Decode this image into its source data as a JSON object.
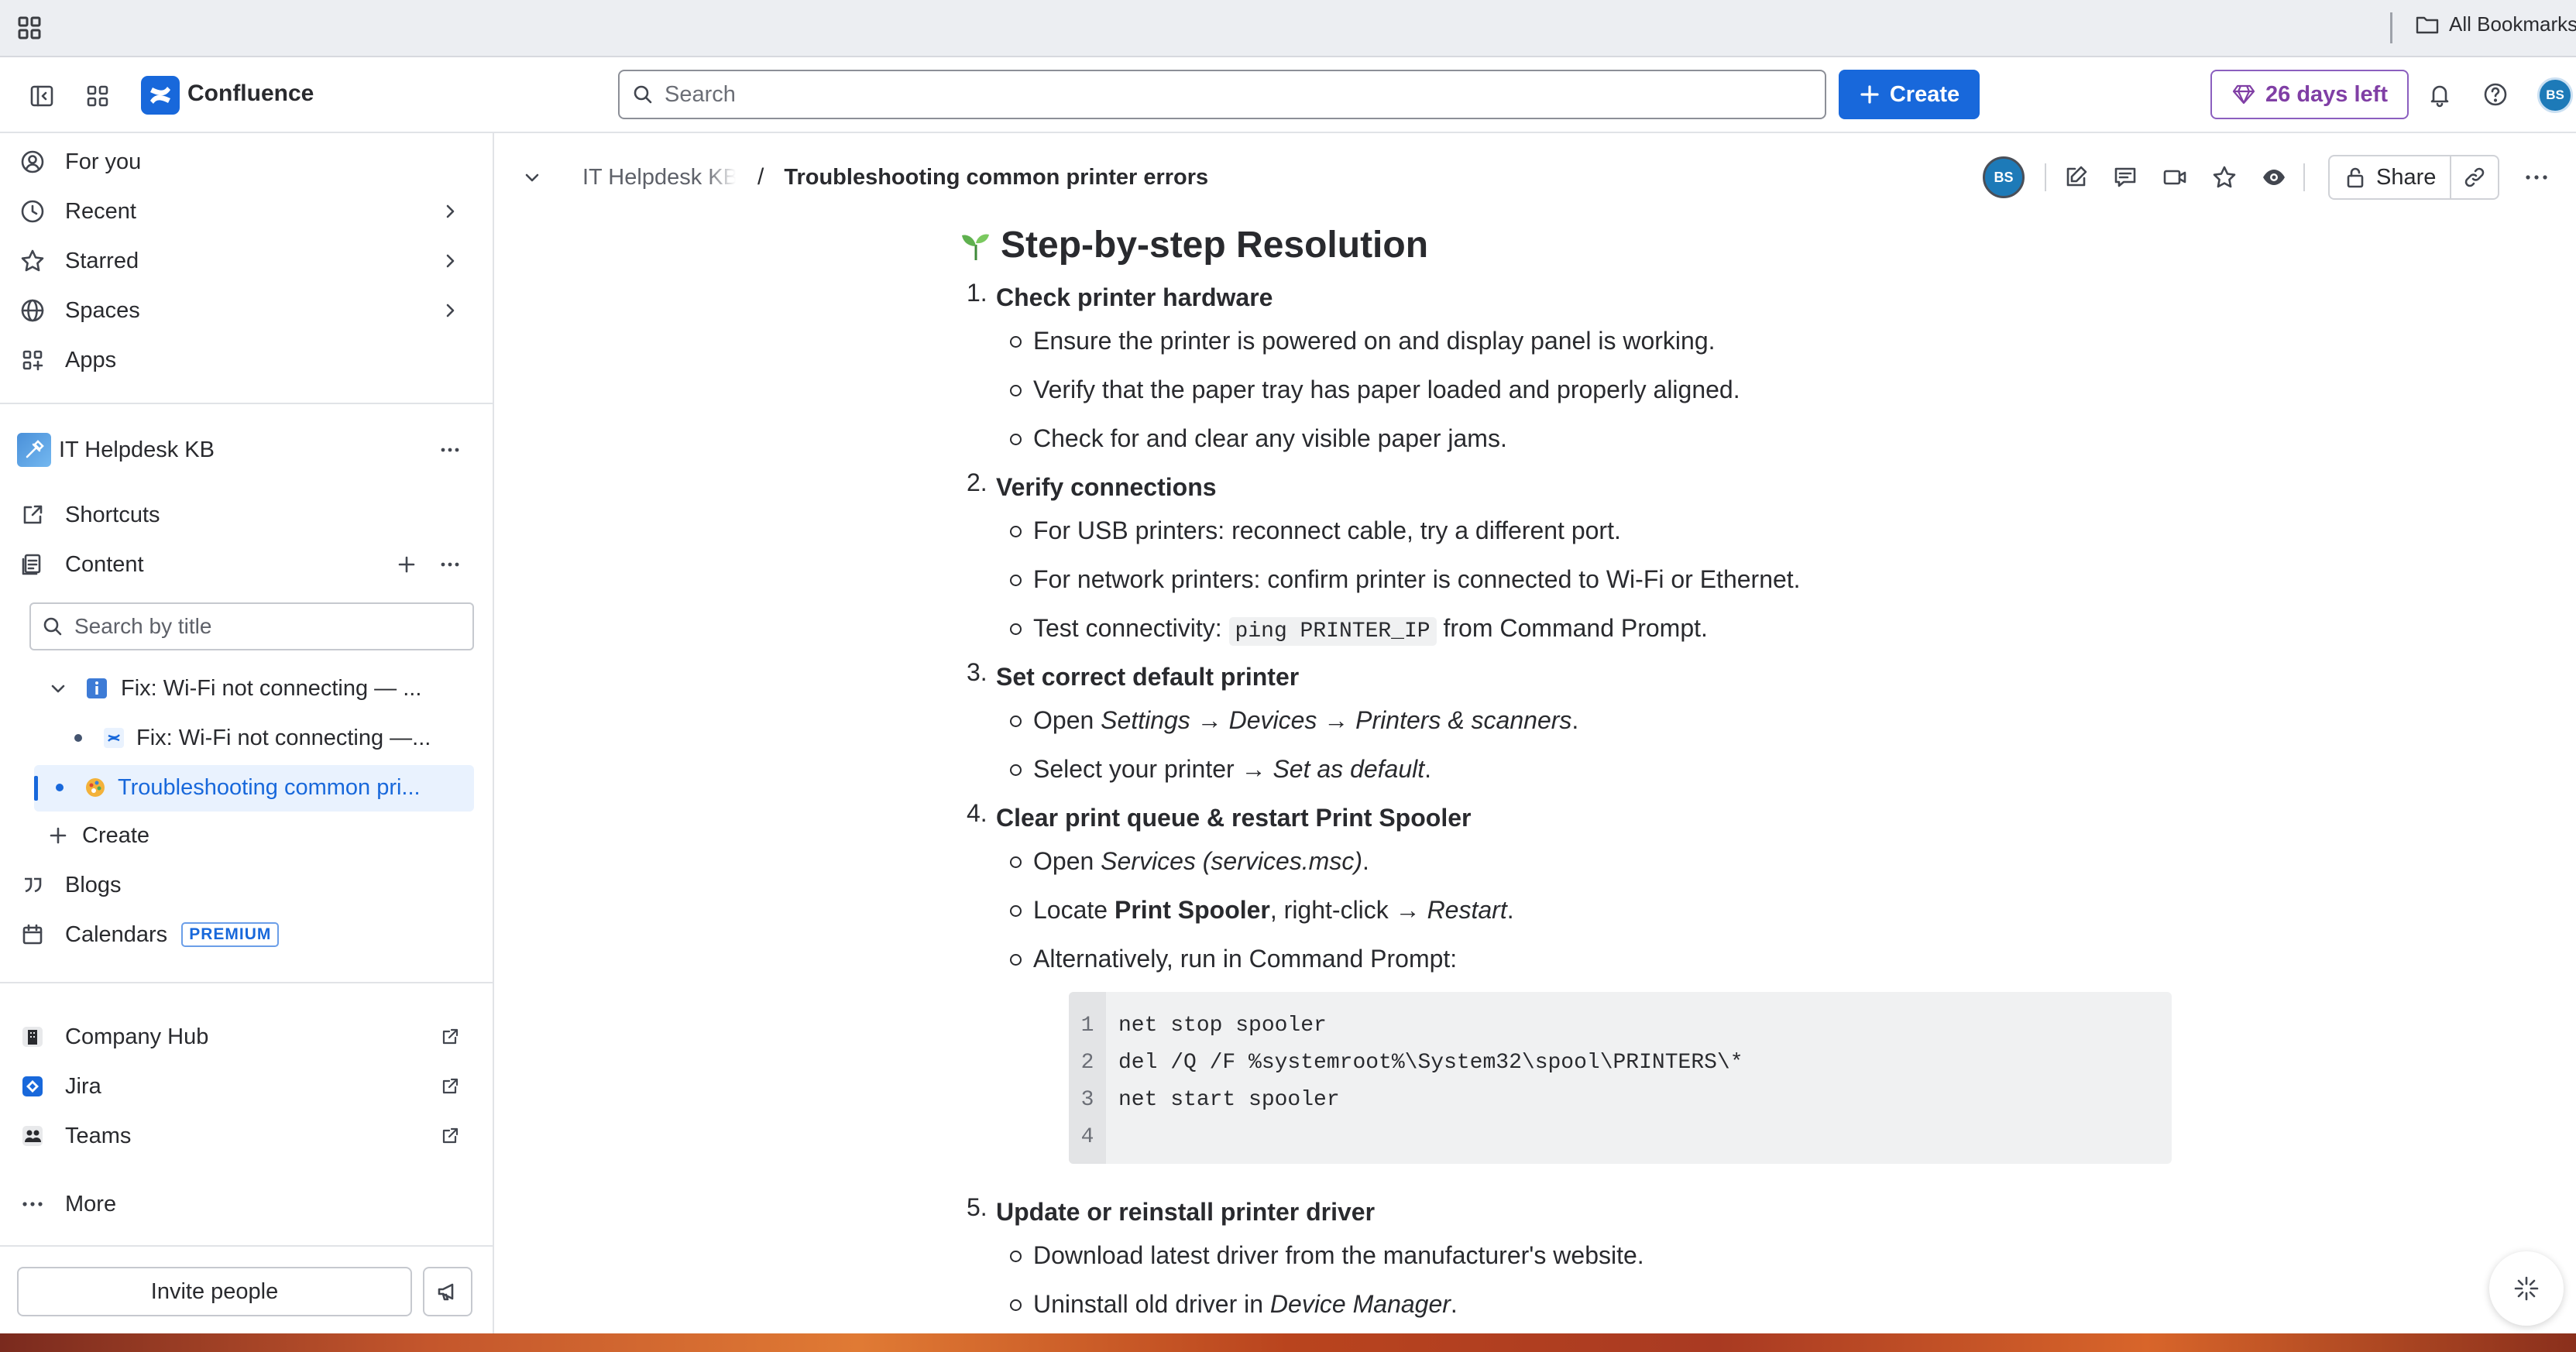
{
  "browser": {
    "bookmarks_label": "All Bookmarks"
  },
  "header": {
    "product_name": "Confluence",
    "search_placeholder": "Search",
    "create_label": "Create",
    "trial_label": "26 days left",
    "avatar_initials": "BS",
    "brand_color": "#1868db"
  },
  "sidebar": {
    "nav": [
      {
        "label": "For you",
        "icon": "person-circle-icon"
      },
      {
        "label": "Recent",
        "icon": "clock-icon"
      },
      {
        "label": "Starred",
        "icon": "star-icon"
      },
      {
        "label": "Spaces",
        "icon": "globe-icon"
      },
      {
        "label": "Apps",
        "icon": "apps-icon"
      }
    ],
    "space": {
      "name": "IT Helpdesk KB",
      "shortcuts_label": "Shortcuts",
      "content_label": "Content",
      "filter_placeholder": "Search by title",
      "tree": [
        {
          "label": "Fix: Wi-Fi not connecting — ...",
          "icon": "info-icon"
        },
        {
          "label": "Fix: Wi-Fi not connecting —...",
          "icon": "confluence-page-icon"
        },
        {
          "label": "Troubleshooting common pri...",
          "icon": "printer-emoji-icon",
          "active": true
        }
      ],
      "create_label": "Create",
      "blogs_label": "Blogs",
      "calendars_label": "Calendars",
      "premium_badge": "PREMIUM"
    },
    "apps": [
      {
        "label": "Company Hub"
      },
      {
        "label": "Jira"
      },
      {
        "label": "Teams"
      }
    ],
    "more_label": "More",
    "invite_label": "Invite people"
  },
  "page": {
    "breadcrumb_space": "IT Helpdesk KB",
    "breadcrumb_separator": "/",
    "title": "Troubleshooting common printer errors",
    "avatar_initials": "BS",
    "share_label": "Share",
    "heading": "Step-by-step Resolution",
    "steps": [
      {
        "num": "1.",
        "title": "Check printer hardware",
        "items": [
          "Ensure the printer is powered on and display panel is working.",
          "Verify that the paper tray has paper loaded and properly aligned.",
          "Check for and clear any visible paper jams."
        ]
      },
      {
        "num": "2.",
        "title": "Verify connections",
        "items": [
          "For USB printers: reconnect cable, try a different port.",
          "For network printers: confirm printer is connected to Wi-Fi or Ethernet."
        ],
        "connectivity": {
          "before": "Test connectivity: ",
          "code": "ping PRINTER_IP",
          "after": " from Command Prompt."
        }
      },
      {
        "num": "3.",
        "title": "Set correct default printer",
        "open_prefix": "Open ",
        "open_path": "Settings → Devices → Printers & scanners",
        "open_suffix": ".",
        "select_prefix": "Select your printer → ",
        "select_action": "Set as default",
        "select_suffix": "."
      },
      {
        "num": "4.",
        "title": "Clear print queue & restart Print Spooler",
        "open_prefix": "Open ",
        "open_target": "Services (services.msc)",
        "open_suffix": ".",
        "locate_prefix": "Locate ",
        "locate_bold": "Print Spooler",
        "locate_mid": ", right-click → ",
        "locate_action": "Restart",
        "locate_suffix": ".",
        "alt_label": "Alternatively, run in Command Prompt:",
        "code_lines": [
          "net stop spooler",
          "del /Q /F %systemroot%\\System32\\spool\\PRINTERS\\*",
          "net start spooler",
          ""
        ],
        "line_numbers": [
          "1",
          "2",
          "3",
          "4"
        ]
      },
      {
        "num": "5.",
        "title": "Update or reinstall printer driver",
        "download": "Download latest driver from the manufacturer's website.",
        "uninstall_prefix": "Uninstall old driver in ",
        "uninstall_target": "Device Manager",
        "uninstall_suffix": "."
      }
    ]
  }
}
